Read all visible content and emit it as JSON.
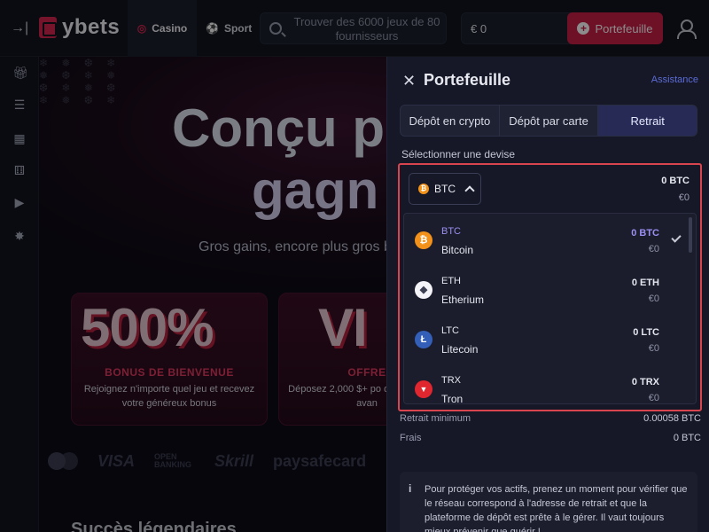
{
  "header": {
    "brand": "ybets",
    "nav": [
      {
        "label": "Casino",
        "icon": "casino-chips-icon",
        "active": true
      },
      {
        "label": "Sport",
        "icon": "sport-ball-icon",
        "active": false
      }
    ],
    "search_placeholder": "Trouver des 6000 jeux de 80 fournisseurs",
    "balance": "€ 0",
    "wallet_button": "Portefeuille"
  },
  "sidebar": {
    "icons": [
      "collapse-icon",
      "gift-icon",
      "list-search-icon",
      "grid-icon",
      "dice-icon",
      "play-icon",
      "star-burst-icon"
    ]
  },
  "hero": {
    "title_line1": "Conçu p",
    "title_line2": "gagn",
    "subtitle": "Gros gains, encore plus gros b",
    "promos": [
      {
        "big": "500%",
        "title": "BONUS DE BIENVENUE",
        "desc": "Rejoignez n'importe quel jeu et recevez votre généreux bonus"
      },
      {
        "big": "VI",
        "title": "OFFRE",
        "desc": "Déposez 2,000 $+ po débloquer des avan"
      }
    ],
    "payments": [
      "VISA",
      "OPEN BANKING",
      "Skrill",
      "paysafecard"
    ],
    "section_title": "Succès légendaires"
  },
  "wallet": {
    "title": "Portefeuille",
    "assistance": "Assistance",
    "tabs": [
      {
        "label": "Dépôt en crypto",
        "active": false
      },
      {
        "label": "Dépôt par carte",
        "active": false
      },
      {
        "label": "Retrait",
        "active": true
      }
    ],
    "currency_label": "Sélectionner une devise",
    "selected": {
      "code": "BTC",
      "amount": "0 BTC",
      "fiat": "€0"
    },
    "currencies": [
      {
        "code": "BTC",
        "name": "Bitcoin",
        "amount": "0 BTC",
        "fiat": "€0",
        "color": "#f2921b",
        "symbol": "₿",
        "selected": true
      },
      {
        "code": "ETH",
        "name": "Etherium",
        "amount": "0 ETH",
        "fiat": "€0",
        "color": "#f4f4f8",
        "symbol": "◆",
        "selected": false
      },
      {
        "code": "LTC",
        "name": "Litecoin",
        "amount": "0 LTC",
        "fiat": "€0",
        "color": "#345fb8",
        "symbol": "Ł",
        "selected": false
      },
      {
        "code": "TRX",
        "name": "Tron",
        "amount": "0 TRX",
        "fiat": "€0",
        "color": "#e0262f",
        "symbol": "▼",
        "selected": false
      }
    ],
    "min_withdraw_label": "Retrait minimum",
    "min_withdraw_value": "0.00058 BTC",
    "fees_label": "Frais",
    "fees_value": "0 BTC",
    "notice": "Pour protéger vos actifs, prenez un moment pour vérifier que le réseau correspond à l'adresse de retrait et que la plateforme de dépôt est prête à le gérer. Il vaut toujours mieux prévenir que guérir !"
  }
}
